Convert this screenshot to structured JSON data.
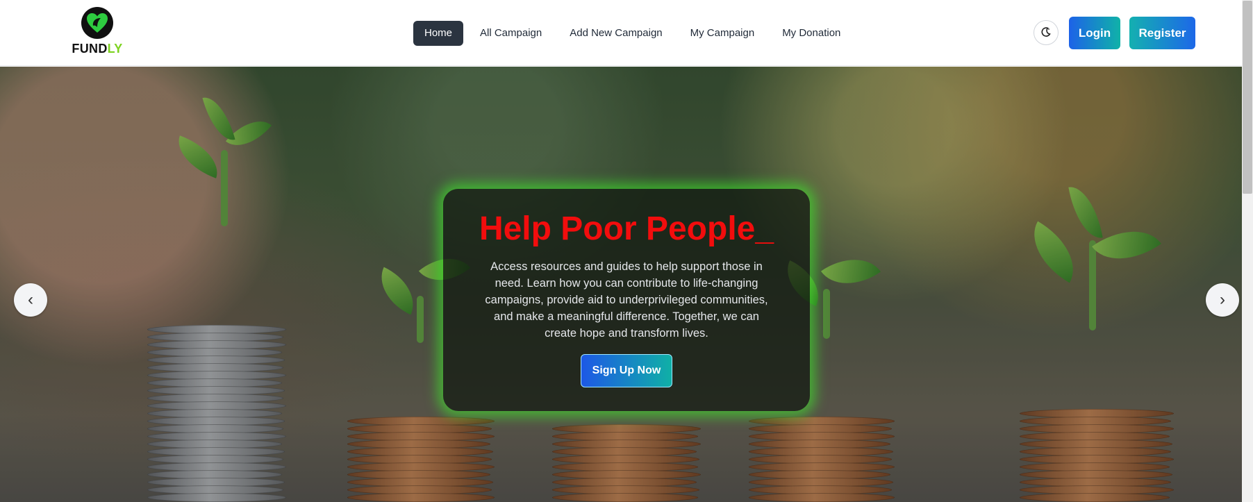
{
  "brand": {
    "prefix": "FUND",
    "accent": "LY",
    "accent_color": "#7ed321"
  },
  "nav": {
    "items": [
      {
        "label": "Home",
        "active": true
      },
      {
        "label": "All Campaign",
        "active": false
      },
      {
        "label": "Add New Campaign",
        "active": false
      },
      {
        "label": "My Campaign",
        "active": false
      },
      {
        "label": "My Donation",
        "active": false
      }
    ]
  },
  "header": {
    "theme_icon": "moon-icon",
    "login_label": "Login",
    "register_label": "Register"
  },
  "hero": {
    "title": "Help Poor People_",
    "title_color": "#f20d0d",
    "description": "Access resources and guides to help support those in need. Learn how you can contribute to life-changing campaigns, provide aid to underprivileged communities, and make a meaningful difference. Together, we can create hope and transform lives.",
    "cta_label": "Sign Up Now",
    "prev_label": "‹",
    "next_label": "›",
    "glow_color": "#3cff28"
  }
}
